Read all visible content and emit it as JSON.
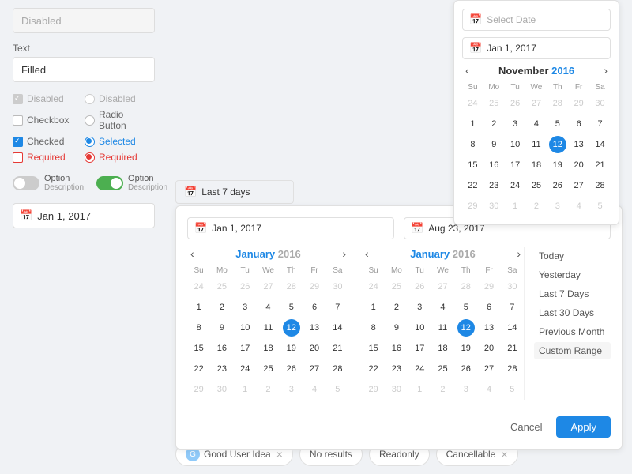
{
  "leftPanel": {
    "disabledLabel": "Disabled",
    "textLabel": "Text",
    "filledValue": "Filled",
    "checkboxes": {
      "disabledLabel": "Disabled",
      "checkboxLabel": "Checkbox",
      "checkedLabel": "Checked",
      "requiredLabel": "Required"
    },
    "radios": {
      "disabledLabel": "Disabled",
      "radioButtonLabel": "Radio Button",
      "selectedLabel": "Selected",
      "requiredLabel": "Required"
    },
    "toggles": {
      "option1Label": "Option",
      "option1Desc": "Description",
      "option2Label": "Option",
      "option2Desc": "Description"
    },
    "dateInput": "Jan 1, 2017"
  },
  "smallCalendar": {
    "selectDatePlaceholder": "Select Date",
    "selectedDate": "Jan 1, 2017",
    "monthLabel": "November",
    "yearLabel": "2016",
    "dayHeaders": [
      "Su",
      "Mo",
      "Tu",
      "We",
      "Th",
      "Fr",
      "Sa"
    ],
    "rows": [
      [
        "24",
        "25",
        "26",
        "27",
        "28",
        "29",
        "30"
      ],
      [
        "1",
        "2",
        "3",
        "4",
        "5",
        "6",
        "7"
      ],
      [
        "8",
        "9",
        "10",
        "11",
        "12",
        "13",
        "14"
      ],
      [
        "15",
        "16",
        "17",
        "18",
        "19",
        "20",
        "21"
      ],
      [
        "22",
        "23",
        "24",
        "25",
        "26",
        "27",
        "28"
      ],
      [
        "29",
        "30",
        "1",
        "2",
        "3",
        "4",
        "5"
      ]
    ],
    "selectedDay": "12",
    "otherMonthRows": [
      0,
      5
    ]
  },
  "last7Bar": {
    "label": "Last 7 days"
  },
  "dateRangePicker": {
    "startDate": "Jan 1, 2017",
    "endDate": "Aug 23, 2017",
    "leftCalendar": {
      "monthLabel": "January",
      "yearLabel": "2016",
      "dayHeaders": [
        "Su",
        "Mo",
        "Tu",
        "We",
        "Th",
        "Fr",
        "Sa"
      ],
      "rows": [
        [
          "24",
          "25",
          "26",
          "27",
          "28",
          "29",
          "30"
        ],
        [
          "1",
          "2",
          "3",
          "4",
          "5",
          "6",
          "7"
        ],
        [
          "8",
          "9",
          "10",
          "11",
          "12",
          "13",
          "14"
        ],
        [
          "15",
          "16",
          "17",
          "18",
          "19",
          "20",
          "21"
        ],
        [
          "22",
          "23",
          "24",
          "25",
          "26",
          "27",
          "28"
        ],
        [
          "29",
          "30",
          "1",
          "2",
          "3",
          "4",
          "5"
        ]
      ],
      "selectedDay": "12",
      "otherMonthFirstRow": true,
      "otherMonthLastRow": true
    },
    "rightCalendar": {
      "monthLabel": "January",
      "yearLabel": "2016",
      "dayHeaders": [
        "Su",
        "Mo",
        "Tu",
        "We",
        "Th",
        "Fr",
        "Sa"
      ],
      "rows": [
        [
          "24",
          "25",
          "26",
          "27",
          "28",
          "29",
          "30"
        ],
        [
          "1",
          "2",
          "3",
          "4",
          "5",
          "6",
          "7"
        ],
        [
          "8",
          "9",
          "10",
          "11",
          "12",
          "13",
          "14"
        ],
        [
          "15",
          "16",
          "17",
          "18",
          "19",
          "20",
          "21"
        ],
        [
          "22",
          "23",
          "24",
          "25",
          "26",
          "27",
          "28"
        ],
        [
          "29",
          "30",
          "1",
          "2",
          "3",
          "4",
          "5"
        ]
      ],
      "selectedDay": "12",
      "otherMonthFirstRow": true,
      "otherMonthLastRow": true
    },
    "shortcuts": [
      "Today",
      "Yesterday",
      "Last 7 Days",
      "Last 30 Days",
      "Previous Month",
      "Custom Range"
    ],
    "activeShortcut": "Custom Range",
    "cancelLabel": "Cancel",
    "applyLabel": "Apply"
  },
  "bottomChips": [
    {
      "type": "avatar",
      "label": "Good User Idea",
      "initials": "G"
    },
    {
      "type": "text",
      "label": "No results"
    },
    {
      "type": "text",
      "label": "Readonly"
    },
    {
      "type": "text",
      "label": "Cancellable"
    }
  ],
  "colors": {
    "accent": "#1e88e5",
    "selected": "#1e88e5",
    "required": "#e53935"
  }
}
